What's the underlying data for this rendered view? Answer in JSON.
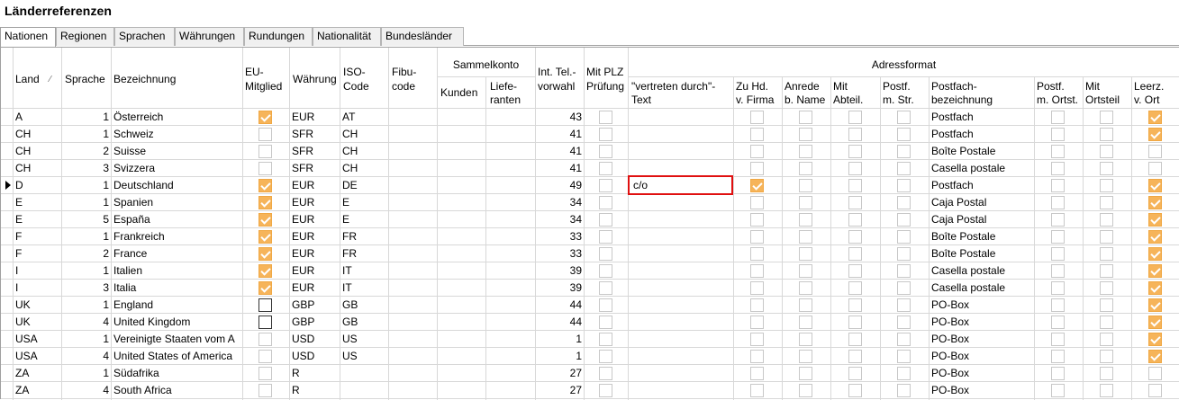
{
  "title": "Länderreferenzen",
  "tabs": [
    {
      "label": "Nationen",
      "active": true
    },
    {
      "label": "Regionen"
    },
    {
      "label": "Sprachen"
    },
    {
      "label": "Währungen"
    },
    {
      "label": "Rundungen"
    },
    {
      "label": "Nationalität"
    },
    {
      "label": "Bundesländer"
    }
  ],
  "headers": {
    "land": "Land",
    "sprache": "Sprache",
    "bezeichnung": "Bezeichnung",
    "eu1": "EU-",
    "eu2": "Mitglied",
    "waehrung": "Währung",
    "iso1": "ISO-",
    "iso2": "Code",
    "fibu1": "Fibu-",
    "fibu2": "code",
    "sammelkonto": "Sammelkonto",
    "kunden": "Kunden",
    "liefe1": "Liefe-",
    "liefe2": "ranten",
    "intel1": "Int. Tel.-",
    "intel2": "vorwahl",
    "plz1": "Mit PLZ",
    "plz2": "Prüfung",
    "adressformat": "Adressformat",
    "vertreten1": "\"vertreten durch\"-",
    "vertreten2": "Text",
    "zuhd1": "Zu Hd.",
    "zuhd2": "v. Firma",
    "anrede1": "Anrede",
    "anrede2": "b. Name",
    "mitabt1": "Mit",
    "mitabt2": "Abteil.",
    "postfstr1": "Postf.",
    "postfstr2": "m. Str.",
    "postfbez1": "Postfach-",
    "postfbez2": "bezeichnung",
    "postfort1": "Postf.",
    "postfort2": "m. Ortst.",
    "mitort1": "Mit",
    "mitort2": "Ortsteil",
    "leerz1": "Leerz.",
    "leerz2": "v. Ort"
  },
  "rows": [
    {
      "land": "A",
      "sprache": "1",
      "bez": "Österreich",
      "eu": "on",
      "waehrung": "EUR",
      "iso": "AT",
      "tel": "43",
      "vertreten": "",
      "zuhd": false,
      "postfach": "Postfach",
      "leerz": true
    },
    {
      "land": "CH",
      "sprache": "1",
      "bez": "Schweiz",
      "eu": "off",
      "waehrung": "SFR",
      "iso": "CH",
      "tel": "41",
      "vertreten": "",
      "zuhd": false,
      "postfach": "Postfach",
      "leerz": true
    },
    {
      "land": "CH",
      "sprache": "2",
      "bez": "Suisse",
      "eu": "off",
      "waehrung": "SFR",
      "iso": "CH",
      "tel": "41",
      "vertreten": "",
      "zuhd": false,
      "postfach": "Boîte Postale",
      "leerz": false
    },
    {
      "land": "CH",
      "sprache": "3",
      "bez": "Svizzera",
      "eu": "off",
      "waehrung": "SFR",
      "iso": "CH",
      "tel": "41",
      "vertreten": "",
      "zuhd": false,
      "postfach": "Casella postale",
      "leerz": false
    },
    {
      "land": "D",
      "sprache": "1",
      "bez": "Deutschland",
      "eu": "on",
      "waehrung": "EUR",
      "iso": "DE",
      "tel": "49",
      "vertreten": "c/o",
      "zuhd": true,
      "postfach": "Postfach",
      "leerz": true
    },
    {
      "land": "E",
      "sprache": "1",
      "bez": "Spanien",
      "eu": "on",
      "waehrung": "EUR",
      "iso": "E",
      "tel": "34",
      "vertreten": "",
      "zuhd": false,
      "postfach": "Caja Postal",
      "leerz": true
    },
    {
      "land": "E",
      "sprache": "5",
      "bez": "España",
      "eu": "on",
      "waehrung": "EUR",
      "iso": "E",
      "tel": "34",
      "vertreten": "",
      "zuhd": false,
      "postfach": "Caja Postal",
      "leerz": true
    },
    {
      "land": "F",
      "sprache": "1",
      "bez": "Frankreich",
      "eu": "on",
      "waehrung": "EUR",
      "iso": "FR",
      "tel": "33",
      "vertreten": "",
      "zuhd": false,
      "postfach": "Boîte Postale",
      "leerz": true
    },
    {
      "land": "F",
      "sprache": "2",
      "bez": "France",
      "eu": "on",
      "waehrung": "EUR",
      "iso": "FR",
      "tel": "33",
      "vertreten": "",
      "zuhd": false,
      "postfach": "Boîte Postale",
      "leerz": true
    },
    {
      "land": "I",
      "sprache": "1",
      "bez": "Italien",
      "eu": "on",
      "waehrung": "EUR",
      "iso": "IT",
      "tel": "39",
      "vertreten": "",
      "zuhd": false,
      "postfach": "Casella postale",
      "leerz": true
    },
    {
      "land": "I",
      "sprache": "3",
      "bez": "Italia",
      "eu": "on",
      "waehrung": "EUR",
      "iso": "IT",
      "tel": "39",
      "vertreten": "",
      "zuhd": false,
      "postfach": "Casella postale",
      "leerz": true
    },
    {
      "land": "UK",
      "sprache": "1",
      "bez": "England",
      "eu": "dark",
      "waehrung": "GBP",
      "iso": "GB",
      "tel": "44",
      "vertreten": "",
      "zuhd": false,
      "postfach": "PO-Box",
      "leerz": true
    },
    {
      "land": "UK",
      "sprache": "4",
      "bez": "United Kingdom",
      "eu": "dark",
      "waehrung": "GBP",
      "iso": "GB",
      "tel": "44",
      "vertreten": "",
      "zuhd": false,
      "postfach": "PO-Box",
      "leerz": true
    },
    {
      "land": "USA",
      "sprache": "1",
      "bez": "Vereinigte Staaten vom A",
      "eu": "off",
      "waehrung": "USD",
      "iso": "US",
      "tel": "1",
      "vertreten": "",
      "zuhd": false,
      "postfach": "PO-Box",
      "leerz": true
    },
    {
      "land": "USA",
      "sprache": "4",
      "bez": "United States of America",
      "eu": "off",
      "waehrung": "USD",
      "iso": "US",
      "tel": "1",
      "vertreten": "",
      "zuhd": false,
      "postfach": "PO-Box",
      "leerz": true
    },
    {
      "land": "ZA",
      "sprache": "1",
      "bez": "Südafrika",
      "eu": "off",
      "waehrung": "R",
      "iso": "",
      "tel": "27",
      "vertreten": "",
      "zuhd": false,
      "postfach": "PO-Box",
      "leerz": false
    },
    {
      "land": "ZA",
      "sprache": "4",
      "bez": "South Africa",
      "eu": "off",
      "waehrung": "R",
      "iso": "",
      "tel": "27",
      "vertreten": "",
      "zuhd": false,
      "postfach": "PO-Box",
      "leerz": false
    }
  ],
  "selected_row": 4,
  "colors": {
    "checked": "#f6b45a",
    "edit_border": "#e01010",
    "grid_line": "#d8d8d8"
  }
}
